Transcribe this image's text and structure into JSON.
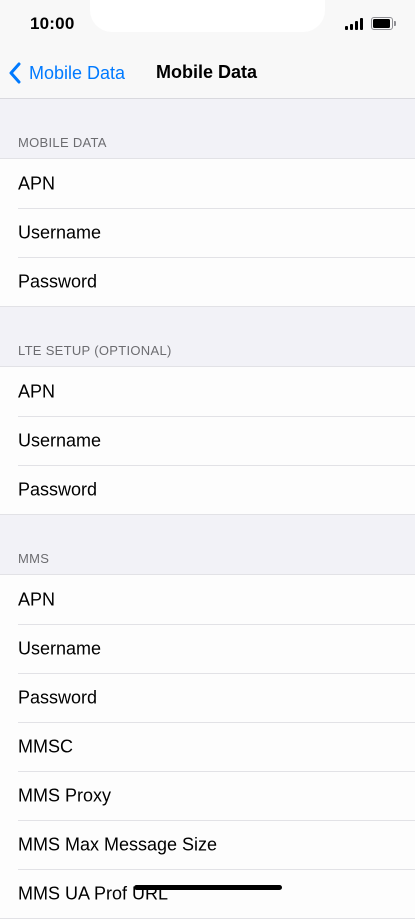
{
  "status_bar": {
    "time": "10:00"
  },
  "nav": {
    "back_label": "Mobile Data",
    "title": "Mobile Data"
  },
  "sections": [
    {
      "header": "MOBILE DATA",
      "rows": [
        "APN",
        "Username",
        "Password"
      ]
    },
    {
      "header": "LTE SETUP (OPTIONAL)",
      "rows": [
        "APN",
        "Username",
        "Password"
      ]
    },
    {
      "header": "MMS",
      "rows": [
        "APN",
        "Username",
        "Password",
        "MMSC",
        "MMS Proxy",
        "MMS Max Message Size",
        "MMS UA Prof URL"
      ]
    }
  ],
  "colors": {
    "accent": "#007aff",
    "background": "#f2f2f7",
    "cell": "#fdfdfd",
    "secondary_text": "#6c6c70"
  }
}
